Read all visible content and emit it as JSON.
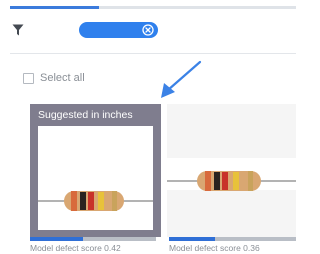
{
  "progress": {
    "fraction": 0.31
  },
  "filter": {
    "icon": "filter-funnel-icon",
    "chip_icon": "close-circle-icon",
    "chip_color": "#2f80ed"
  },
  "select_all": {
    "label": "Select all"
  },
  "cards": [
    {
      "title": "Suggested in inches",
      "score_label": "Model defect score 0.42",
      "score": 0.42
    },
    {
      "score_label": "Model defect score 0.36",
      "score": 0.36
    }
  ],
  "colors": {
    "accent": "#2f80ed",
    "selected_card": "#7f7d8e"
  }
}
